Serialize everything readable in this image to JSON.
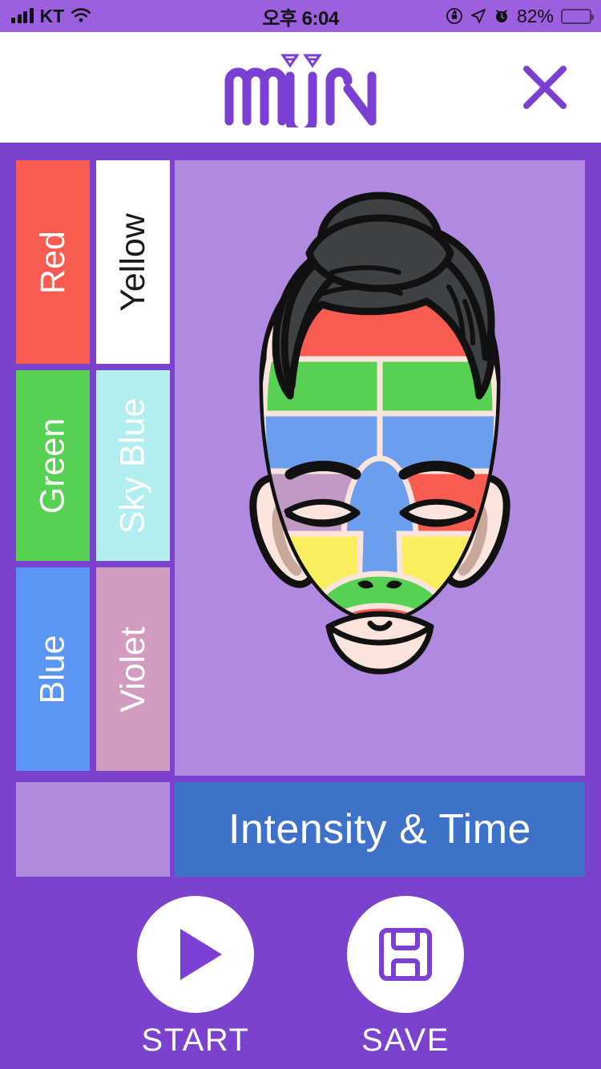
{
  "status_bar": {
    "carrier": "KT",
    "signal_icon": "signal-bars-icon",
    "wifi_icon": "wifi-icon",
    "time": "오후 6:04",
    "rotation_lock_icon": "rotation-lock-icon",
    "location_icon": "location-arrow-icon",
    "alarm_icon": "alarm-clock-icon",
    "battery_percent": "82%",
    "battery_icon": "battery-full-icon",
    "background_color": "#9B5FE0"
  },
  "header": {
    "logo_text": "MIIN",
    "logo_icon": "miin-logo",
    "logo_color": "#7B3FD4",
    "close_icon": "close-icon",
    "close_color": "#7B3FD4",
    "background_color": "#FFFFFF"
  },
  "main": {
    "background_color": "#7B42CE",
    "panel_color": "#AF8AE0"
  },
  "colors": [
    {
      "label": "Red",
      "swatch": "#F85B50",
      "text_color": "#FFFFFF"
    },
    {
      "label": "Yellow",
      "swatch": "#FFFFFF",
      "text_color": "#1A1A1A"
    },
    {
      "label": "Green",
      "swatch": "#57D154",
      "text_color": "#FFFFFF"
    },
    {
      "label": "Sky Blue",
      "swatch": "#B2EDF0",
      "text_color": "#FFFFFF"
    },
    {
      "label": "Blue",
      "swatch": "#5A96F5",
      "text_color": "#FFFFFF"
    },
    {
      "label": "Violet",
      "swatch": "#D29CC0",
      "text_color": "#FFFFFF"
    }
  ],
  "empty_tile": {
    "color": "#B08BDD"
  },
  "intensity": {
    "label": "Intensity & Time",
    "background_color": "#3E71C8",
    "text_color": "#FFFFFF"
  },
  "actions": [
    {
      "label": "START",
      "icon": "play-icon",
      "icon_color": "#7B3FD4",
      "circle_color": "#FFFFFF"
    },
    {
      "label": "SAVE",
      "icon": "floppy-disk-icon",
      "icon_color": "#7B3FD4",
      "circle_color": "#FFFFFF"
    }
  ],
  "face_map": {
    "title": "face-treatment-zone-map",
    "skin_color": "#FBE4DC",
    "hair_color": "#3F4244",
    "outline_color": "#111111",
    "ear_inner_color": "#C7A89B",
    "zones": [
      {
        "name": "forehead-top",
        "color": "#F85B50",
        "assigned": "Red"
      },
      {
        "name": "forehead-mid-left",
        "color": "#57D154",
        "assigned": "Green"
      },
      {
        "name": "forehead-mid-right",
        "color": "#57D154",
        "assigned": "Green"
      },
      {
        "name": "forehead-low-left",
        "color": "#6C9EEE",
        "assigned": "Blue"
      },
      {
        "name": "forehead-low-right",
        "color": "#6C9EEE",
        "assigned": "Blue"
      },
      {
        "name": "eye-zone-left",
        "color": "#C09AC4",
        "assigned": "Violet"
      },
      {
        "name": "eye-zone-right",
        "color": "#F85B50",
        "assigned": "Red"
      },
      {
        "name": "nose",
        "color": "#6C9EEE",
        "assigned": "Blue"
      },
      {
        "name": "cheek-left",
        "color": "#FAEE5F",
        "assigned": "Yellow"
      },
      {
        "name": "cheek-right",
        "color": "#FAEE5F",
        "assigned": "Yellow"
      },
      {
        "name": "jaw-side-left",
        "color": "#C09AC4",
        "assigned": "Violet"
      },
      {
        "name": "jaw-side-right",
        "color": "#C09AC4",
        "assigned": "Violet"
      },
      {
        "name": "mouth-area",
        "color": "#57D154",
        "assigned": "Green"
      },
      {
        "name": "upper-lip",
        "color": "#F85B50",
        "assigned": "Red"
      },
      {
        "name": "chin",
        "color": "#B2EDF0",
        "assigned": "Sky Blue"
      }
    ]
  }
}
